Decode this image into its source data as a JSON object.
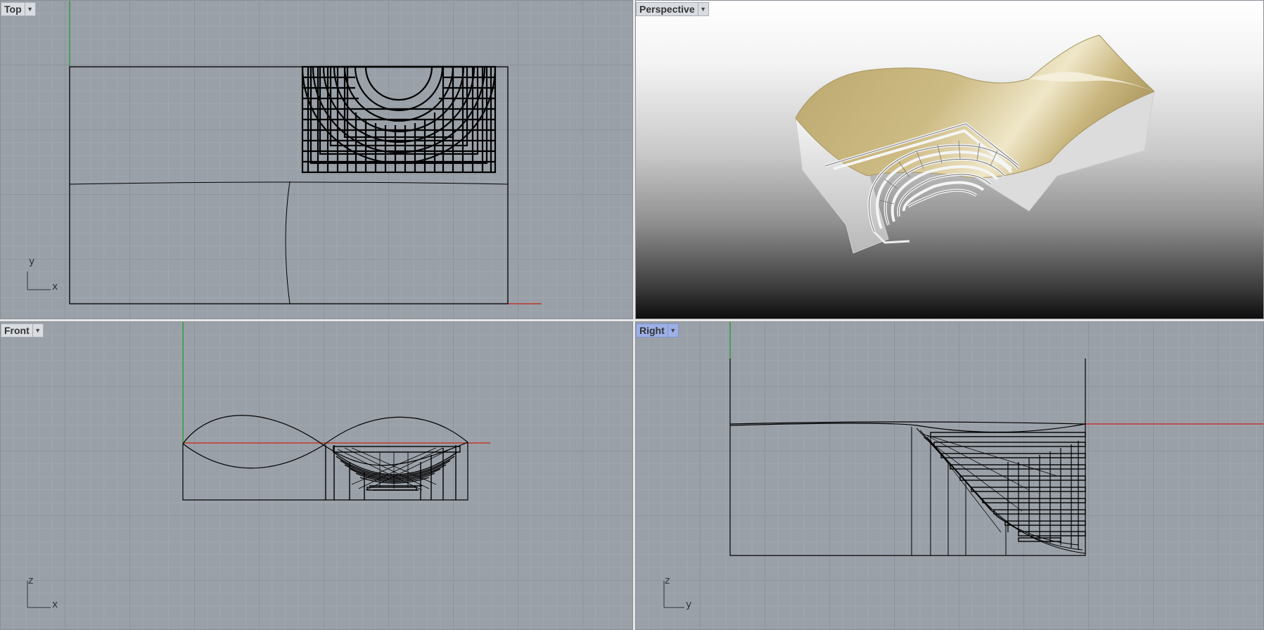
{
  "viewports": {
    "top": {
      "label": "Top",
      "axis_v": "y",
      "axis_h": "x"
    },
    "perspective": {
      "label": "Perspective"
    },
    "front": {
      "label": "Front",
      "axis_v": "z",
      "axis_h": "x"
    },
    "right": {
      "label": "Right",
      "axis_v": "z",
      "axis_h": "y",
      "active": true
    }
  },
  "icons": {
    "dropdown": "chevron-down-icon"
  },
  "colors": {
    "viewport_bg": "#9aa0a8",
    "grid_major": "#8d939c",
    "x_axis": "#c0392b",
    "y_axis": "#2e9e3f",
    "active_tab": "#9db0e6",
    "surface": "#c8b67e",
    "geometry": "#000000"
  }
}
